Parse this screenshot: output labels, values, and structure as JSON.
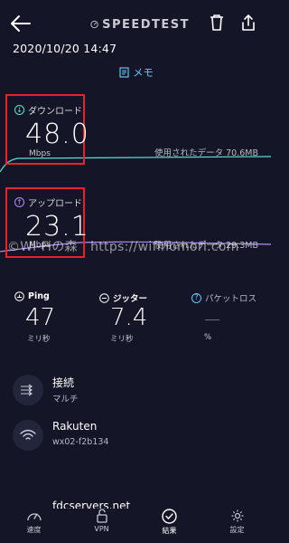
{
  "header": {
    "brand": "SPEEDTEST",
    "datetime": "2020/10/20 14:47",
    "memo_label": "メモ"
  },
  "download": {
    "label": "ダウンロード",
    "value": "48.0",
    "unit": "Mbps",
    "data_used": "使用されたデータ 70.6MB"
  },
  "upload": {
    "label": "アップロード",
    "value": "23.1",
    "unit": "Mbps",
    "data_used": "使用されたデータ 29.3MB"
  },
  "watermark": "©Wi-Fiの森　https://wifinomori.com",
  "stats": {
    "ping": {
      "label": "Ping",
      "value": "47",
      "unit": "ミリ秒"
    },
    "jitter": {
      "label": "ジッター",
      "value": "7.4",
      "unit": "ミリ秒"
    },
    "packet_loss": {
      "label": "パケットロス",
      "value": "—",
      "unit": "%"
    }
  },
  "connection": {
    "title": "接続",
    "subtitle": "マルチ"
  },
  "provider": {
    "title": "Rakuten",
    "subtitle": "wx02-f2b134"
  },
  "server": {
    "title": "fdcservers.net"
  },
  "nav": {
    "speed": "速度",
    "vpn": "VPN",
    "results": "結果",
    "settings": "設定"
  },
  "colors": {
    "background": "#141526",
    "download_line": "#5ee0d0",
    "upload_line": "#b58cf5",
    "accent": "#5fc4f5",
    "highlight": "#e5232d"
  }
}
